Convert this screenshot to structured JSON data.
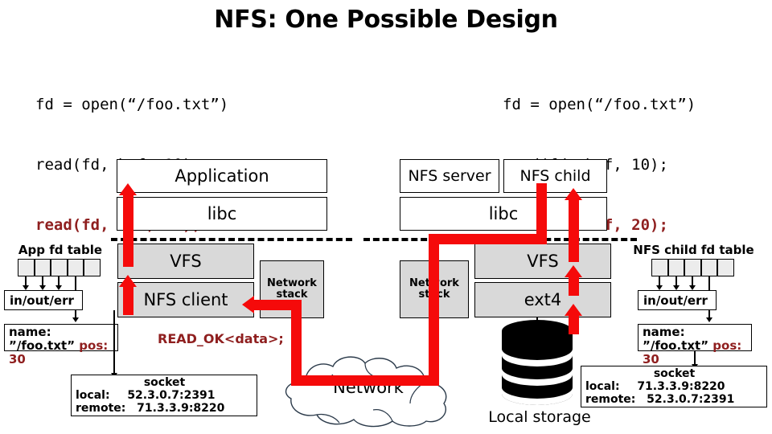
{
  "title": "NFS: One Possible Design",
  "colors": {
    "red_arrow": "#f50a0a",
    "dark_red_text": "#8f1f1f",
    "kernel_box_fill": "#d9d9d9",
    "fd_cell_fill": "#ececec",
    "background": "#ffffff"
  },
  "code_left": {
    "line1": "fd = open(“/foo.txt”)",
    "line2": "read(fd, buf, 10);",
    "line3_highlight": "read(fd, buf, 20);"
  },
  "code_right": {
    "line1": "fd = open(“/foo.txt”)",
    "line2": "read(fd, buf, 10);",
    "line3_highlight": "read(fd, buf, 20);"
  },
  "client": {
    "application": "Application",
    "libc": "libc",
    "vfs": "VFS",
    "nfs_client": "NFS client",
    "network_stack": "Network\nstack",
    "network_stack_line1": "Network",
    "network_stack_line2": "stack",
    "fd_table_title": "App fd table",
    "fd_cells": [
      "",
      "",
      "",
      "",
      ""
    ],
    "in_out_err": "in/out/err",
    "file_entry": {
      "name": "name: ”/foo.txt”",
      "pos": "pos: 30"
    },
    "socket": {
      "title": "socket",
      "local_label": "local:",
      "local_value": "52.3.0.7:2391",
      "remote_label": "remote:",
      "remote_value": "71.3.3.9:8220"
    },
    "message": "READ_OK<data>;"
  },
  "server": {
    "nfs_server": "NFS server",
    "nfs_child": "NFS child",
    "libc": "libc",
    "vfs": "VFS",
    "ext4": "ext4",
    "network_stack_line1": "Network",
    "network_stack_line2": "stack",
    "fd_table_title": "NFS child fd table",
    "fd_cells": [
      "",
      "",
      "",
      "",
      ""
    ],
    "in_out_err": "in/out/err",
    "file_entry": {
      "name": "name: ”/foo.txt”",
      "pos": "pos: 30"
    },
    "socket": {
      "title": "socket",
      "local_label": "local:",
      "local_value": "71.3.3.9:8220",
      "remote_label": "remote:",
      "remote_value": "52.3.0.7:2391"
    },
    "storage_label": "Local storage"
  },
  "network": {
    "label": "Network"
  }
}
